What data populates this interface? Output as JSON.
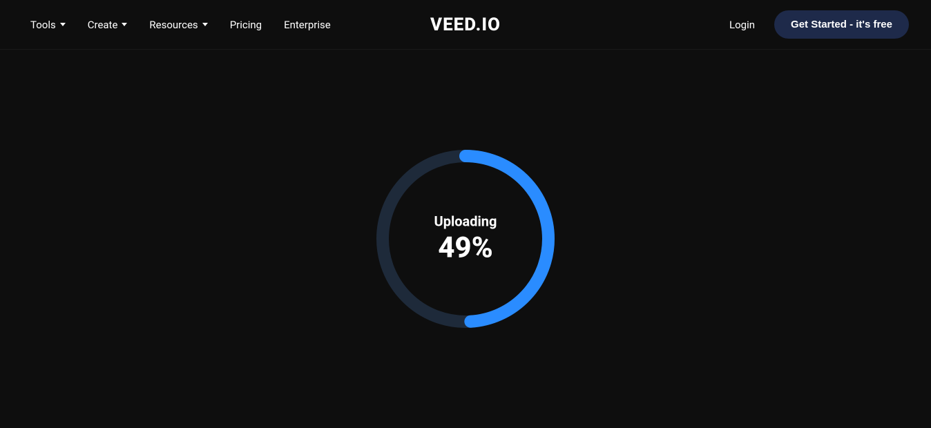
{
  "header": {
    "logo": "VEED.IO",
    "nav": {
      "tools_label": "Tools",
      "create_label": "Create",
      "resources_label": "Resources",
      "pricing_label": "Pricing",
      "enterprise_label": "Enterprise"
    },
    "login_label": "Login",
    "cta_label": "Get Started - it's free"
  },
  "main": {
    "uploading_label": "Uploading",
    "percent_label": "49%",
    "progress_value": 49
  }
}
